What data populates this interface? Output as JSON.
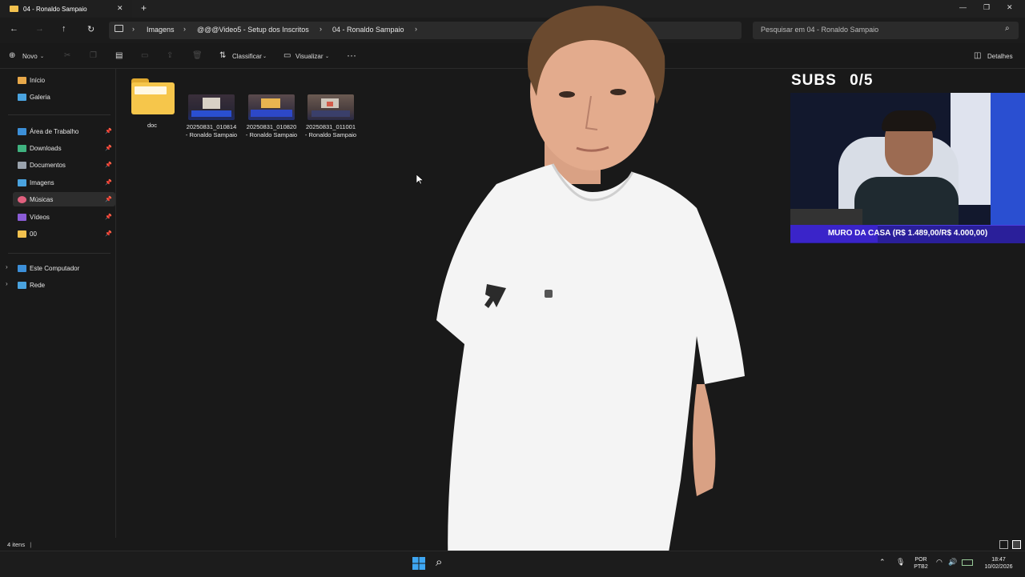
{
  "window": {
    "tab_title": "04 - Ronaldo Sampaio",
    "new_tab": "+",
    "close_tab": "✕",
    "controls": {
      "minimize": "—",
      "maximize": "❐",
      "close": "✕"
    }
  },
  "address": {
    "breadcrumbs": [
      "Imagens",
      "@@@Video5 - Setup dos Inscritos",
      "04 - Ronaldo Sampaio"
    ],
    "search_placeholder": "Pesquisar em 04 - Ronaldo Sampaio"
  },
  "toolbar": {
    "new_label": "Novo",
    "sort_label": "Classificar",
    "view_label": "Visualizar",
    "more_label": "···",
    "details_label": "Detalhes"
  },
  "sidebar": {
    "quick": [
      {
        "label": "Início",
        "icon": "home-icon",
        "color": "#e8a849"
      },
      {
        "label": "Galeria",
        "icon": "gallery-icon",
        "color": "#4aa3df"
      }
    ],
    "pinned": [
      {
        "label": "Área de Trabalho",
        "icon": "desktop-icon",
        "color": "#3c8fd8"
      },
      {
        "label": "Downloads",
        "icon": "downloads-icon",
        "color": "#3fb27f"
      },
      {
        "label": "Documentos",
        "icon": "documents-icon",
        "color": "#9aa3ad"
      },
      {
        "label": "Imagens",
        "icon": "pictures-icon",
        "color": "#4aa3df"
      },
      {
        "label": "Músicas",
        "icon": "music-icon",
        "color": "#e0607e"
      },
      {
        "label": "Vídeos",
        "icon": "videos-icon",
        "color": "#8a5cd6"
      },
      {
        "label": "00",
        "icon": "folder-icon",
        "color": "#f2c14e"
      }
    ],
    "selected": "Músicas",
    "drives": [
      {
        "label": "Este Computador",
        "icon": "computer-icon",
        "color": "#3c8fd8"
      },
      {
        "label": "Rede",
        "icon": "network-icon",
        "color": "#4aa3df"
      }
    ]
  },
  "files": [
    {
      "name": "doc",
      "type": "folder"
    },
    {
      "name": "20250831_010814 - Ronaldo Sampaio",
      "type": "image"
    },
    {
      "name": "20250831_010820 - Ronaldo Sampaio",
      "type": "image"
    },
    {
      "name": "20250831_011001 - Ronaldo Sampaio",
      "type": "image"
    }
  ],
  "status": {
    "count": "4 itens"
  },
  "taskbar": {
    "lang_line1": "POR",
    "lang_line2": "PTB2",
    "time": "18:47",
    "date": "10/02/2026"
  },
  "overlay": {
    "subs_label": "SUBS",
    "subs_count": "0/5",
    "muro_text": "MURO DA CASA (R$ 1.489,00/R$ 4.000,00)",
    "muro_progress": 0.372
  }
}
